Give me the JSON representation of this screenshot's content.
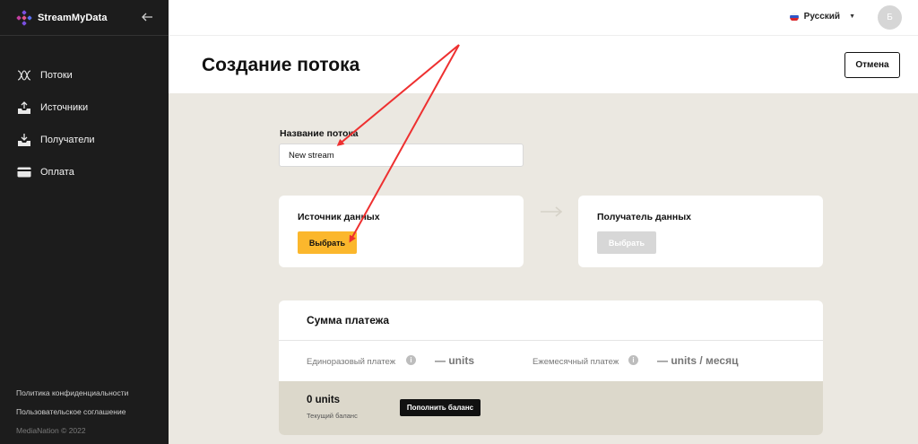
{
  "app": {
    "name": "StreamMyData"
  },
  "sidebar": {
    "items": [
      {
        "label": "Потоки",
        "icon": "streams-icon"
      },
      {
        "label": "Источники",
        "icon": "upload-tray-icon"
      },
      {
        "label": "Получатели",
        "icon": "download-tray-icon"
      },
      {
        "label": "Оплата",
        "icon": "credit-card-icon"
      }
    ],
    "footer": {
      "privacy": "Политика конфиденциальности",
      "terms": "Пользовательское соглашение",
      "copyright": "MediaNation © 2022"
    }
  },
  "topbar": {
    "language": "Русский",
    "avatar_initial": "Б"
  },
  "page": {
    "title": "Создание потока",
    "cancel_label": "Отмена"
  },
  "stream_name": {
    "label": "Название потока",
    "value": "New stream"
  },
  "source": {
    "title": "Источник данных",
    "button": "Выбрать"
  },
  "destination": {
    "title": "Получатель данных",
    "button": "Выбрать"
  },
  "payment": {
    "title": "Сумма платежа",
    "one_time_label": "Единоразовый платеж",
    "one_time_value": "— units",
    "monthly_label": "Ежемесячный платеж",
    "monthly_value": "— units / месяц",
    "info_glyph": "i",
    "balance_value": "0 units",
    "balance_caption": "Текущий баланс",
    "topup_label": "Пополнить баланс"
  },
  "colors": {
    "sidebar_bg": "#1c1c1c",
    "content_bg": "#ebe8e1",
    "accent": "#fbb72c",
    "annotation": "#ee3030"
  }
}
